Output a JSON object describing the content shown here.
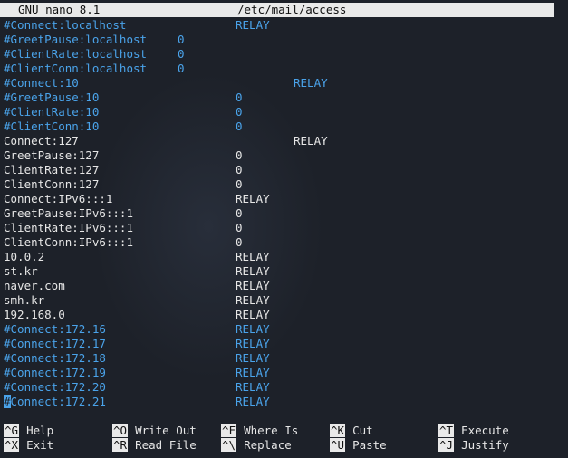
{
  "title_bar": {
    "app": "GNU nano 8.1",
    "file": "/etc/mail/access"
  },
  "lines": [
    {
      "key": "#Connect:localhost",
      "value": "RELAY",
      "commented": true,
      "col": "a"
    },
    {
      "key": "#GreetPause:localhost",
      "value": "0",
      "commented": true,
      "col": "c"
    },
    {
      "key": "#ClientRate:localhost",
      "value": "0",
      "commented": true,
      "col": "c"
    },
    {
      "key": "#ClientConn:localhost",
      "value": "0",
      "commented": true,
      "col": "c"
    },
    {
      "key": "#Connect:10",
      "value": "RELAY",
      "commented": true,
      "col": "b"
    },
    {
      "key": "#GreetPause:10",
      "value": "0",
      "commented": true,
      "col": "a"
    },
    {
      "key": "#ClientRate:10",
      "value": "0",
      "commented": true,
      "col": "a"
    },
    {
      "key": "#ClientConn:10",
      "value": "0",
      "commented": true,
      "col": "a"
    },
    {
      "key": "Connect:127",
      "value": "RELAY",
      "commented": false,
      "col": "b"
    },
    {
      "key": "GreetPause:127",
      "value": "0",
      "commented": false,
      "col": "a"
    },
    {
      "key": "ClientRate:127",
      "value": "0",
      "commented": false,
      "col": "a"
    },
    {
      "key": "ClientConn:127",
      "value": "0",
      "commented": false,
      "col": "a"
    },
    {
      "key": "Connect:IPv6:::1",
      "value": "RELAY",
      "commented": false,
      "col": "a"
    },
    {
      "key": "GreetPause:IPv6:::1",
      "value": "0",
      "commented": false,
      "col": "a"
    },
    {
      "key": "ClientRate:IPv6:::1",
      "value": "0",
      "commented": false,
      "col": "a"
    },
    {
      "key": "ClientConn:IPv6:::1",
      "value": "0",
      "commented": false,
      "col": "a"
    },
    {
      "key": "10.0.2",
      "value": "RELAY",
      "commented": false,
      "col": "a"
    },
    {
      "key": "st.kr",
      "value": "RELAY",
      "commented": false,
      "col": "a"
    },
    {
      "key": "naver.com",
      "value": "RELAY",
      "commented": false,
      "col": "a"
    },
    {
      "key": "smh.kr",
      "value": "RELAY",
      "commented": false,
      "col": "a"
    },
    {
      "key": "192.168.0",
      "value": "RELAY",
      "commented": false,
      "col": "a"
    },
    {
      "key": "#Connect:172.16",
      "value": "RELAY",
      "commented": true,
      "col": "a"
    },
    {
      "key": "#Connect:172.17",
      "value": "RELAY",
      "commented": true,
      "col": "a"
    },
    {
      "key": "#Connect:172.18",
      "value": "RELAY",
      "commented": true,
      "col": "a"
    },
    {
      "key": "#Connect:172.19",
      "value": "RELAY",
      "commented": true,
      "col": "a"
    },
    {
      "key": "#Connect:172.20",
      "value": "RELAY",
      "commented": true,
      "col": "a"
    },
    {
      "key": "#Connect:172.21",
      "value": "RELAY",
      "commented": true,
      "col": "a",
      "cursor": true
    }
  ],
  "shortcuts": {
    "row1": [
      {
        "key": "^G",
        "label": "Help"
      },
      {
        "key": "^O",
        "label": "Write Out"
      },
      {
        "key": "^F",
        "label": "Where Is"
      },
      {
        "key": "^K",
        "label": "Cut"
      },
      {
        "key": "^T",
        "label": "Execute"
      }
    ],
    "row2": [
      {
        "key": "^X",
        "label": "Exit"
      },
      {
        "key": "^R",
        "label": "Read File"
      },
      {
        "key": "^\\",
        "label": "Replace"
      },
      {
        "key": "^U",
        "label": "Paste"
      },
      {
        "key": "^J",
        "label": "Justify"
      }
    ]
  },
  "colors": {
    "background": "#1d2129",
    "comment": "#4aa3ea",
    "text": "#e6e6e6",
    "bar": "#e9e9e9"
  }
}
